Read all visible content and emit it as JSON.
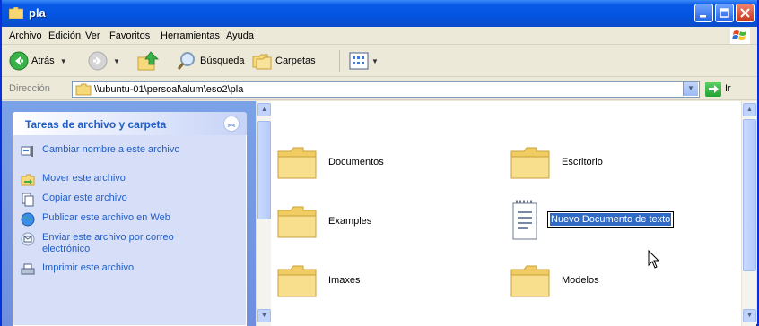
{
  "window": {
    "title": "pla"
  },
  "menu": [
    "Archivo",
    "Edición",
    "Ver",
    "Favoritos",
    "Herramientas",
    "Ayuda"
  ],
  "toolbar": {
    "back_label": "Atrás",
    "search_label": "Búsqueda",
    "folders_label": "Carpetas"
  },
  "address": {
    "label": "Dirección",
    "path": "\\\\ubuntu-01\\persoal\\alum\\eso2\\pla",
    "go_label": "Ir"
  },
  "taskpane": {
    "title": "Tareas de archivo y carpeta",
    "tasks": [
      "Cambiar nombre a este archivo",
      "Mover este archivo",
      "Copiar este archivo",
      "Publicar este archivo en Web",
      "Enviar este archivo por correo electrónico",
      "Imprimir este archivo"
    ]
  },
  "files": [
    {
      "name": "Documentos",
      "type": "folder"
    },
    {
      "name": "Escritorio",
      "type": "folder"
    },
    {
      "name": "Examples",
      "type": "folder"
    },
    {
      "name": "Nuevo Documento de texto",
      "type": "text-document",
      "renaming": true
    },
    {
      "name": "Imaxes",
      "type": "folder"
    },
    {
      "name": "Modelos",
      "type": "folder"
    }
  ],
  "colors": {
    "titlebar": "#0354e0",
    "taskpane": "#6f8ee0",
    "task_link": "#215dc6",
    "selection": "#316ac5",
    "folder": "#f5d97a"
  }
}
